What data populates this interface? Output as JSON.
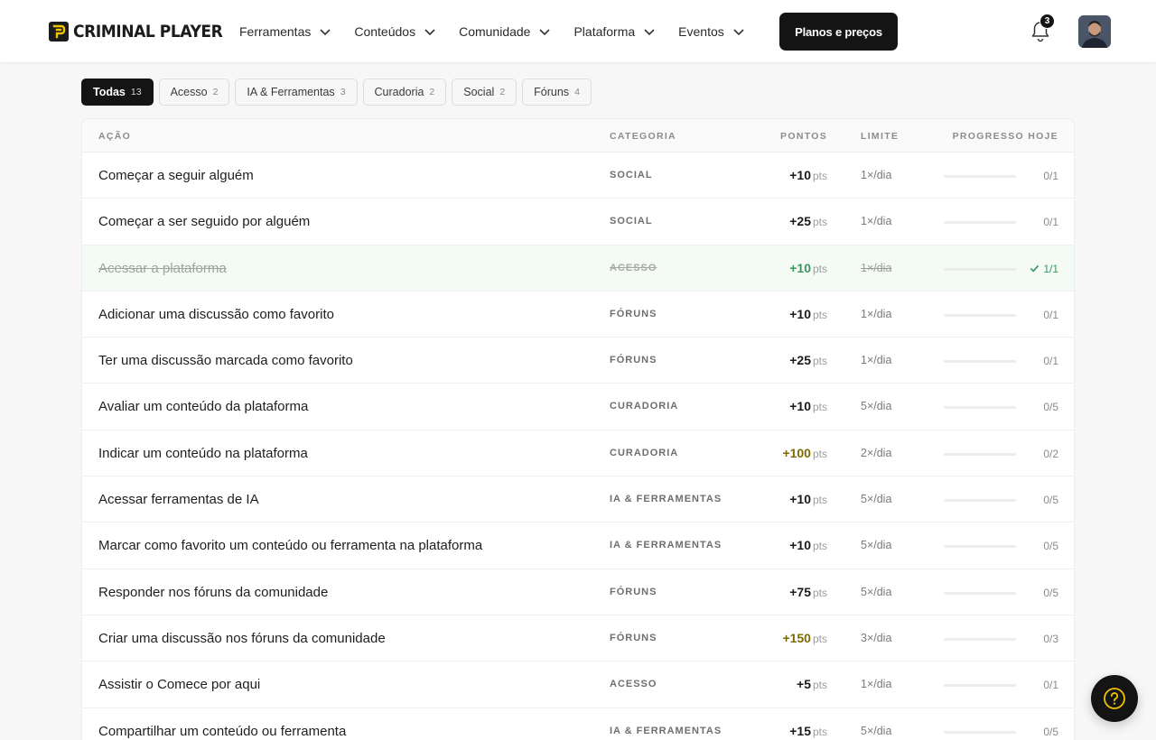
{
  "brand": {
    "name": "CRIMINAL PLAYER",
    "icon": "cp-logo-icon",
    "accent": "#f2c400"
  },
  "nav": {
    "items": [
      {
        "label": "Ferramentas"
      },
      {
        "label": "Conteúdos"
      },
      {
        "label": "Comunidade"
      },
      {
        "label": "Plataforma"
      },
      {
        "label": "Eventos"
      }
    ],
    "cta_label": "Planos e preços"
  },
  "notifications": {
    "count": "3",
    "icon": "bell-icon"
  },
  "user": {
    "avatar_icon": "user-avatar"
  },
  "filters": [
    {
      "label": "Todas",
      "count": "13",
      "active": true
    },
    {
      "label": "Acesso",
      "count": "2",
      "active": false
    },
    {
      "label": "IA & Ferramentas",
      "count": "3",
      "active": false
    },
    {
      "label": "Curadoria",
      "count": "2",
      "active": false
    },
    {
      "label": "Social",
      "count": "2",
      "active": false
    },
    {
      "label": "Fóruns",
      "count": "4",
      "active": false
    }
  ],
  "table": {
    "headers": {
      "action": "AÇÃO",
      "category": "CATEGORIA",
      "points": "PONTOS",
      "limit": "LIMITE",
      "progress": "PROGRESSO HOJE"
    },
    "points_unit": "pts",
    "rows": [
      {
        "action": "Começar a seguir alguém",
        "category": "SOCIAL",
        "points": "+10",
        "limit": "1×/dia",
        "progress": "0/1",
        "progress_value": 0,
        "done": false,
        "highlight": ""
      },
      {
        "action": "Começar a ser seguido por alguém",
        "category": "SOCIAL",
        "points": "+25",
        "limit": "1×/dia",
        "progress": "0/1",
        "progress_value": 0,
        "done": false,
        "highlight": ""
      },
      {
        "action": "Acessar a plataforma",
        "category": "ACESSO",
        "points": "+10",
        "limit": "1×/dia",
        "progress": "1/1",
        "progress_value": 1,
        "done": true,
        "highlight": "green"
      },
      {
        "action": "Adicionar uma discussão como favorito",
        "category": "FÓRUNS",
        "points": "+10",
        "limit": "1×/dia",
        "progress": "0/1",
        "progress_value": 0,
        "done": false,
        "highlight": ""
      },
      {
        "action": "Ter uma discussão marcada como favorito",
        "category": "FÓRUNS",
        "points": "+25",
        "limit": "1×/dia",
        "progress": "0/1",
        "progress_value": 0,
        "done": false,
        "highlight": ""
      },
      {
        "action": "Avaliar um conteúdo da plataforma",
        "category": "CURADORIA",
        "points": "+10",
        "limit": "5×/dia",
        "progress": "0/5",
        "progress_value": 0,
        "done": false,
        "highlight": ""
      },
      {
        "action": "Indicar um conteúdo na plataforma",
        "category": "CURADORIA",
        "points": "+100",
        "limit": "2×/dia",
        "progress": "0/2",
        "progress_value": 0,
        "done": false,
        "highlight": "gold"
      },
      {
        "action": "Acessar ferramentas de IA",
        "category": "IA & FERRAMENTAS",
        "points": "+10",
        "limit": "5×/dia",
        "progress": "0/5",
        "progress_value": 0,
        "done": false,
        "highlight": ""
      },
      {
        "action": "Marcar como favorito um conteúdo ou ferramenta na plataforma",
        "category": "IA & FERRAMENTAS",
        "points": "+10",
        "limit": "5×/dia",
        "progress": "0/5",
        "progress_value": 0,
        "done": false,
        "highlight": ""
      },
      {
        "action": "Responder nos fóruns da comunidade",
        "category": "FÓRUNS",
        "points": "+75",
        "limit": "5×/dia",
        "progress": "0/5",
        "progress_value": 0,
        "done": false,
        "highlight": ""
      },
      {
        "action": "Criar uma discussão nos fóruns da comunidade",
        "category": "FÓRUNS",
        "points": "+150",
        "limit": "3×/dia",
        "progress": "0/3",
        "progress_value": 0,
        "done": false,
        "highlight": "gold"
      },
      {
        "action": "Assistir o Comece por aqui",
        "category": "ACESSO",
        "points": "+5",
        "limit": "1×/dia",
        "progress": "0/1",
        "progress_value": 0,
        "done": false,
        "highlight": ""
      },
      {
        "action": "Compartilhar um conteúdo ou ferramenta",
        "category": "IA & FERRAMENTAS",
        "points": "+15",
        "limit": "5×/dia",
        "progress": "0/5",
        "progress_value": 0,
        "done": false,
        "highlight": ""
      }
    ]
  },
  "help": {
    "icon": "help-icon",
    "accent": "#f2c400"
  }
}
